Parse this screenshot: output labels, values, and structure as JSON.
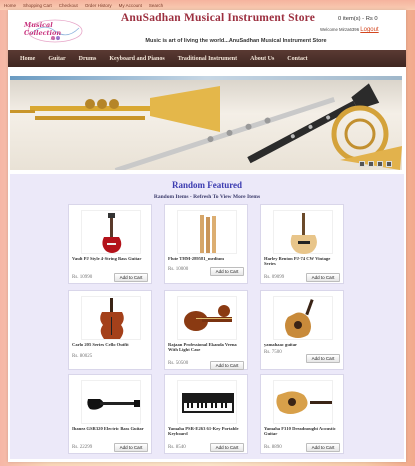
{
  "topbar": {
    "links": [
      "Home",
      "Shopping Cart",
      "Checkout",
      "Order History",
      "My Account",
      "Search"
    ]
  },
  "header": {
    "logo_text": "Musical Collection",
    "logo_subtext": "♪ ♫ ♬",
    "title": "AnuSadhan Musical Instrument Store",
    "tagline": "Music is art of living the world...AnuSadhan Musical Instrument Store",
    "cart_info": "0 item(s) - Rs 0",
    "welcome_text": "Welcome Mirza6396",
    "logout_label": "Logout"
  },
  "nav": {
    "items": [
      "Home",
      "Guitar",
      "Drums",
      "Keyboard and Pianos",
      "Traditional Instrument",
      "About Us",
      "Contact"
    ]
  },
  "featured": {
    "title": "Random Featured",
    "subtitle": "Random Items - Refresh To View More Items",
    "add_label": "Add to Cart",
    "products": [
      {
        "name": "Vault PJ Style 4-String Bass Guitar",
        "price": "Rs. 10990",
        "icon": "bass-guitar-icon"
      },
      {
        "name": "Flute THM-289581_medium",
        "price": "Rs. 10000",
        "icon": "flute-icon"
      },
      {
        "name": "Harley Benton PJ-74 CW Vintage Series",
        "price": "Rs. 09099",
        "icon": "bass-guitar-vintage-icon"
      },
      {
        "name": "Carlo 205 Series Cello Outfit",
        "price": "Rs. 80025",
        "icon": "cello-icon"
      },
      {
        "name": "Rajaan Professional Ekanda Veena With Light Case",
        "price": "Rs. 50500",
        "icon": "veena-icon"
      },
      {
        "name": "yamahaac guitar",
        "price": "Rs. 7500",
        "icon": "acoustic-guitar-icon"
      },
      {
        "name": "Ibanez GSR320 Electric Bass Guitar",
        "price": "Rs. 22299",
        "icon": "electric-bass-icon"
      },
      {
        "name": "Yamaha PSR-E263 61-Key Portable Keyboard",
        "price": "Rs. 8540",
        "icon": "keyboard-icon"
      },
      {
        "name": "Yamaha F310 Dreadnought Acoustic Guitar",
        "price": "Rs. 8890",
        "icon": "dreadnought-guitar-icon"
      }
    ]
  },
  "colors": {
    "title_red": "#9c2f3f",
    "nav_brown": "#4a2d27",
    "featured_blue": "#3b3bb0",
    "logout_orange": "#d3461f"
  }
}
